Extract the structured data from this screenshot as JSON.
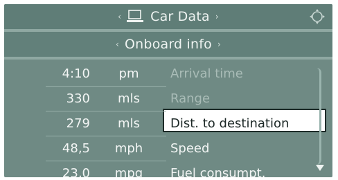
{
  "header": {
    "title": "Car Data",
    "left_arrow": "‹",
    "right_arrow": "›",
    "icon": "car-data-icon",
    "corner_icon": "controller-icon"
  },
  "subheader": {
    "title": "Onboard info",
    "left_arrow": "‹",
    "right_arrow": "›"
  },
  "rows": [
    {
      "value": "4:10",
      "unit": "pm",
      "label": "Arrival time"
    },
    {
      "value": "330",
      "unit": "mls",
      "label": "Range"
    },
    {
      "value": "279",
      "unit": "mls",
      "label": "Dist. to destination"
    },
    {
      "value": "48,5",
      "unit": "mph",
      "label": "Speed"
    },
    {
      "value": "23,0",
      "unit": "mpg",
      "label": "Fuel consumpt."
    }
  ],
  "scroll": {
    "icon": "scroll-down-icon"
  },
  "colors": {
    "panel": "#6f8a84",
    "header": "#5f7d77",
    "selected_bg": "#ffffff",
    "text": "#f2f5f4"
  }
}
